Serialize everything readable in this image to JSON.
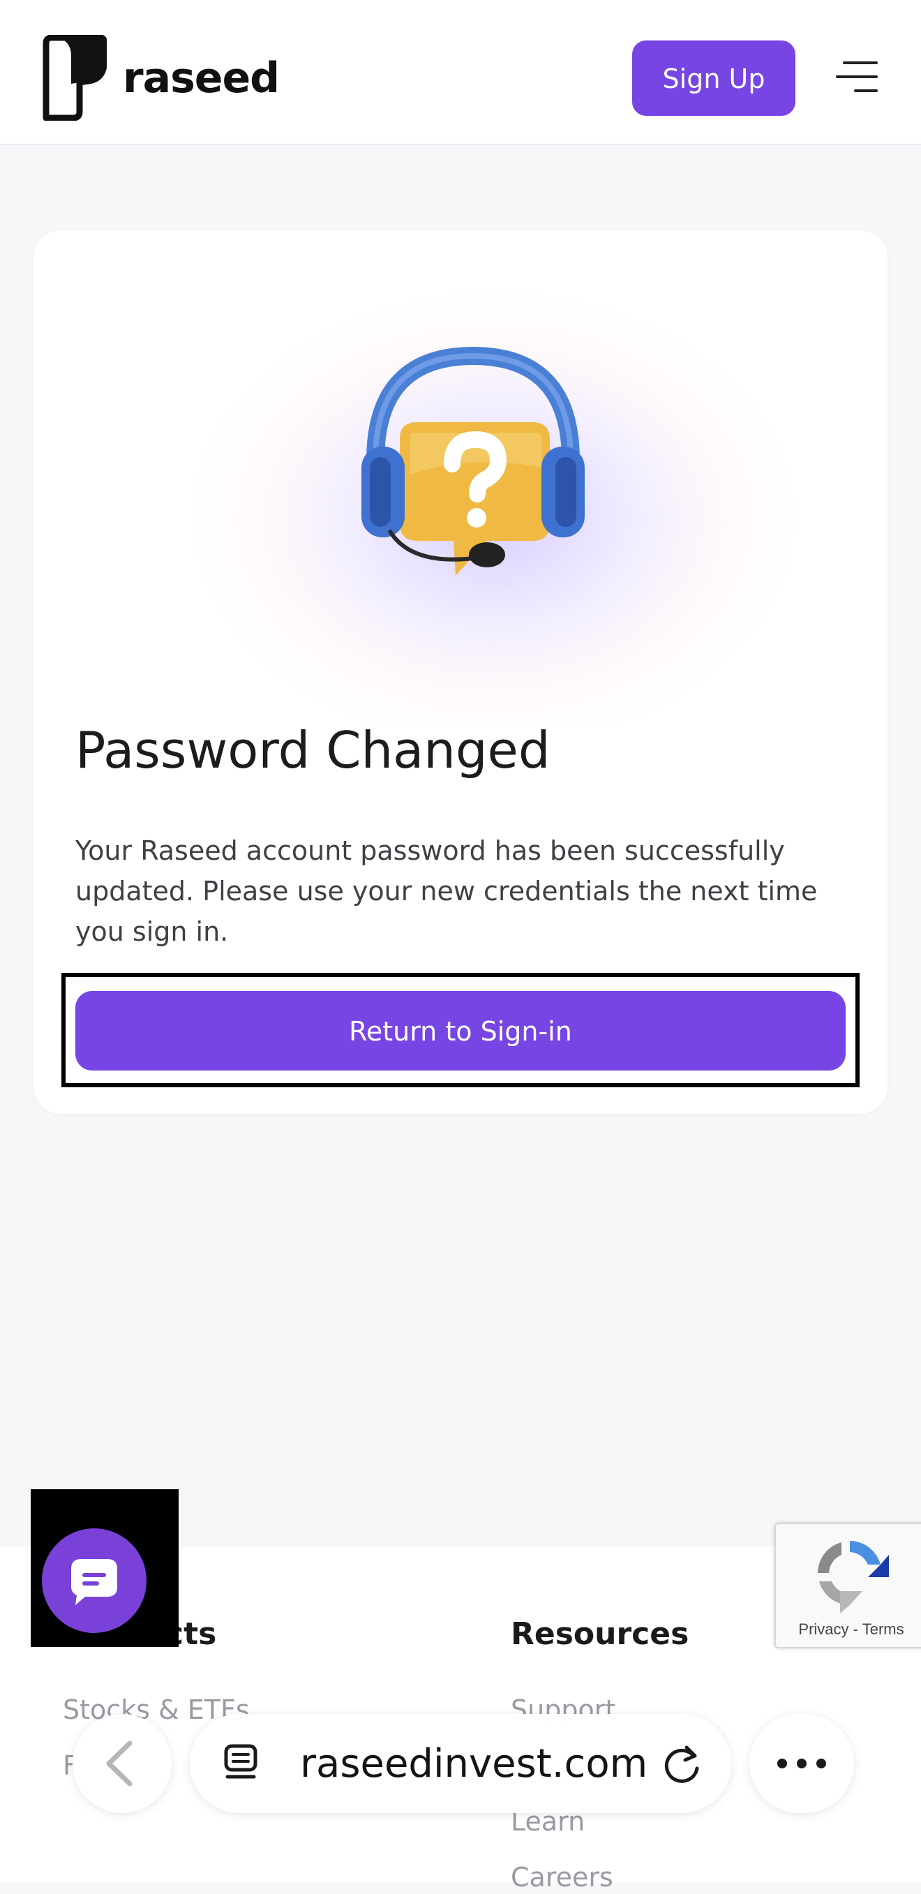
{
  "header": {
    "brand": "raseed",
    "signup_label": "Sign Up"
  },
  "card": {
    "title": "Password Changed",
    "body": "Your Raseed account password has been successfully updated. Please use your new credentials the next time you sign in.",
    "button_label": "Return to Sign-in"
  },
  "footer": {
    "col1_title": "Products",
    "col1_links": [
      "Stocks & ETFs",
      "F"
    ],
    "col2_title": "Resources",
    "col2_links": [
      "Support",
      "Learn",
      "Careers"
    ]
  },
  "recaptcha": {
    "privacy": "Privacy",
    "separator": "-",
    "terms": "Terms"
  },
  "browser": {
    "url": "raseedinvest.com"
  },
  "colors": {
    "accent": "#7645e3",
    "chat_bubble": "#7a41d8",
    "background": "#f7f7f9"
  },
  "icons": {
    "menu": "hamburger-icon",
    "support": "headset-question-icon",
    "chat": "chat-icon",
    "back": "chevron-left-icon",
    "tabs": "tab-overview-icon",
    "reload": "reload-icon",
    "more": "more-dots-icon"
  }
}
